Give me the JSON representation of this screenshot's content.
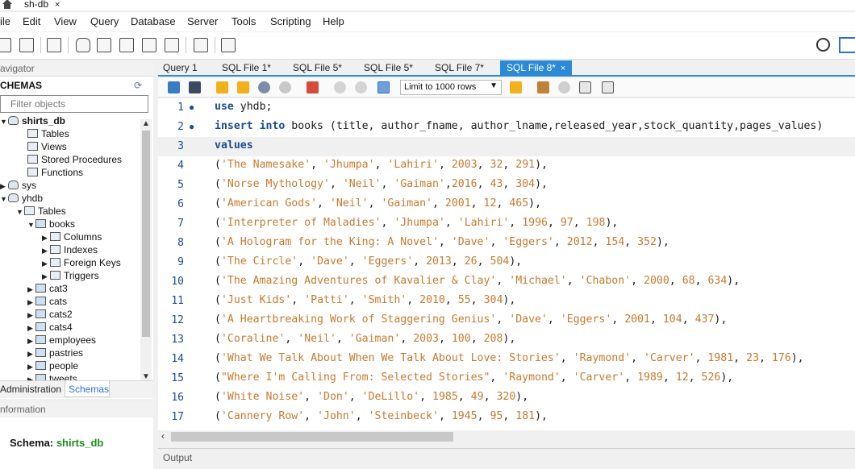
{
  "window": {
    "tab_title": "sh-db",
    "tab_close": "×"
  },
  "menu": [
    "ile",
    "Edit",
    "View",
    "Query",
    "Database",
    "Server",
    "Tools",
    "Scripting",
    "Help"
  ],
  "navigator": {
    "title": "avigator",
    "schemas_label": "CHEMAS",
    "filter_placeholder": "Filter objects",
    "tree": [
      {
        "label": "shirts_db",
        "arrow": "▼",
        "icon": "db",
        "bold": true
      },
      {
        "label": "Tables",
        "icon": "folder"
      },
      {
        "label": "Views",
        "icon": "folder"
      },
      {
        "label": "Stored Procedures",
        "icon": "folder"
      },
      {
        "label": "Functions",
        "icon": "folder"
      },
      {
        "label": "sys",
        "arrow": "▶",
        "icon": "db"
      },
      {
        "label": "yhdb",
        "arrow": "▼",
        "icon": "db"
      },
      {
        "label": "Tables",
        "arrow": "▼",
        "icon": "folder"
      },
      {
        "label": "books",
        "arrow": "▼",
        "icon": "table"
      },
      {
        "label": "Columns",
        "arrow": "▶",
        "icon": "folder"
      },
      {
        "label": "Indexes",
        "arrow": "▶",
        "icon": "folder"
      },
      {
        "label": "Foreign Keys",
        "arrow": "▶",
        "icon": "folder"
      },
      {
        "label": "Triggers",
        "arrow": "▶",
        "icon": "folder"
      },
      {
        "label": "cat3",
        "arrow": "▶",
        "icon": "table"
      },
      {
        "label": "cats",
        "arrow": "▶",
        "icon": "table"
      },
      {
        "label": "cats2",
        "arrow": "▶",
        "icon": "table"
      },
      {
        "label": "cats4",
        "arrow": "▶",
        "icon": "table"
      },
      {
        "label": "employees",
        "arrow": "▶",
        "icon": "table"
      },
      {
        "label": "pastries",
        "arrow": "▶",
        "icon": "table"
      },
      {
        "label": "people",
        "arrow": "▶",
        "icon": "table"
      },
      {
        "label": "tweets",
        "arrow": "▶",
        "icon": "table"
      }
    ],
    "tabs": {
      "admin": "Administration",
      "schemas": "Schemas"
    },
    "info_title": "nformation",
    "schema_info_label": "Schema:",
    "schema_info_value": "shirts_db"
  },
  "query_tabs": [
    {
      "label": "Query 1",
      "active": false
    },
    {
      "label": "SQL File 1*",
      "active": false
    },
    {
      "label": "SQL File 5*",
      "active": false
    },
    {
      "label": "SQL File 5*",
      "active": false
    },
    {
      "label": "SQL File 7*",
      "active": false
    },
    {
      "label": "SQL File 8*",
      "active": true,
      "close": "×"
    }
  ],
  "editor_toolbar": {
    "limit_label": "Limit to 1000 rows"
  },
  "editor": {
    "current_line": 3,
    "lines": [
      {
        "n": "1",
        "dot": true,
        "tokens": [
          [
            "kw",
            "use"
          ],
          [
            "t",
            " yhdb;"
          ]
        ]
      },
      {
        "n": "2",
        "dot": true,
        "tokens": [
          [
            "kw",
            "insert into"
          ],
          [
            "t",
            " books (title, author_fname, author_lname,released_year,stock_quantity,pages_values)"
          ]
        ]
      },
      {
        "n": "3",
        "dot": false,
        "tokens": [
          [
            "kw",
            "values"
          ]
        ]
      },
      {
        "n": "4",
        "dot": false,
        "tokens": [
          [
            "t",
            "("
          ],
          [
            "str",
            "'The Namesake'"
          ],
          [
            "t",
            ", "
          ],
          [
            "str",
            "'Jhumpa'"
          ],
          [
            "t",
            ", "
          ],
          [
            "str",
            "'Lahiri'"
          ],
          [
            "t",
            ", "
          ],
          [
            "num",
            "2003"
          ],
          [
            "t",
            ", "
          ],
          [
            "num",
            "32"
          ],
          [
            "t",
            ", "
          ],
          [
            "num",
            "291"
          ],
          [
            "t",
            "),"
          ]
        ]
      },
      {
        "n": "5",
        "dot": false,
        "tokens": [
          [
            "t",
            "("
          ],
          [
            "str",
            "'Norse Mythology'"
          ],
          [
            "t",
            ", "
          ],
          [
            "str",
            "'Neil'"
          ],
          [
            "t",
            ", "
          ],
          [
            "str",
            "'Gaiman'"
          ],
          [
            "t",
            ","
          ],
          [
            "num",
            "2016"
          ],
          [
            "t",
            ", "
          ],
          [
            "num",
            "43"
          ],
          [
            "t",
            ", "
          ],
          [
            "num",
            "304"
          ],
          [
            "t",
            "),"
          ]
        ]
      },
      {
        "n": "6",
        "dot": false,
        "tokens": [
          [
            "t",
            "("
          ],
          [
            "str",
            "'American Gods'"
          ],
          [
            "t",
            ", "
          ],
          [
            "str",
            "'Neil'"
          ],
          [
            "t",
            ", "
          ],
          [
            "str",
            "'Gaiman'"
          ],
          [
            "t",
            ", "
          ],
          [
            "num",
            "2001"
          ],
          [
            "t",
            ", "
          ],
          [
            "num",
            "12"
          ],
          [
            "t",
            ", "
          ],
          [
            "num",
            "465"
          ],
          [
            "t",
            "),"
          ]
        ]
      },
      {
        "n": "7",
        "dot": false,
        "tokens": [
          [
            "t",
            "("
          ],
          [
            "str",
            "'Interpreter of Maladies'"
          ],
          [
            "t",
            ", "
          ],
          [
            "str",
            "'Jhumpa'"
          ],
          [
            "t",
            ", "
          ],
          [
            "str",
            "'Lahiri'"
          ],
          [
            "t",
            ", "
          ],
          [
            "num",
            "1996"
          ],
          [
            "t",
            ", "
          ],
          [
            "num",
            "97"
          ],
          [
            "t",
            ", "
          ],
          [
            "num",
            "198"
          ],
          [
            "t",
            "),"
          ]
        ]
      },
      {
        "n": "8",
        "dot": false,
        "tokens": [
          [
            "t",
            "("
          ],
          [
            "str",
            "'A Hologram for the King: A Novel'"
          ],
          [
            "t",
            ", "
          ],
          [
            "str",
            "'Dave'"
          ],
          [
            "t",
            ", "
          ],
          [
            "str",
            "'Eggers'"
          ],
          [
            "t",
            ", "
          ],
          [
            "num",
            "2012"
          ],
          [
            "t",
            ", "
          ],
          [
            "num",
            "154"
          ],
          [
            "t",
            ", "
          ],
          [
            "num",
            "352"
          ],
          [
            "t",
            "),"
          ]
        ]
      },
      {
        "n": "9",
        "dot": false,
        "tokens": [
          [
            "t",
            "("
          ],
          [
            "str",
            "'The Circle'"
          ],
          [
            "t",
            ", "
          ],
          [
            "str",
            "'Dave'"
          ],
          [
            "t",
            ", "
          ],
          [
            "str",
            "'Eggers'"
          ],
          [
            "t",
            ", "
          ],
          [
            "num",
            "2013"
          ],
          [
            "t",
            ", "
          ],
          [
            "num",
            "26"
          ],
          [
            "t",
            ", "
          ],
          [
            "num",
            "504"
          ],
          [
            "t",
            "),"
          ]
        ]
      },
      {
        "n": "10",
        "dot": false,
        "tokens": [
          [
            "t",
            "("
          ],
          [
            "str",
            "'The Amazing Adventures of Kavalier & Clay'"
          ],
          [
            "t",
            ", "
          ],
          [
            "str",
            "'Michael'"
          ],
          [
            "t",
            ", "
          ],
          [
            "str",
            "'Chabon'"
          ],
          [
            "t",
            ", "
          ],
          [
            "num",
            "2000"
          ],
          [
            "t",
            ", "
          ],
          [
            "num",
            "68"
          ],
          [
            "t",
            ", "
          ],
          [
            "num",
            "634"
          ],
          [
            "t",
            "),"
          ]
        ]
      },
      {
        "n": "11",
        "dot": false,
        "tokens": [
          [
            "t",
            "("
          ],
          [
            "str",
            "'Just Kids'"
          ],
          [
            "t",
            ", "
          ],
          [
            "str",
            "'Patti'"
          ],
          [
            "t",
            ", "
          ],
          [
            "str",
            "'Smith'"
          ],
          [
            "t",
            ", "
          ],
          [
            "num",
            "2010"
          ],
          [
            "t",
            ", "
          ],
          [
            "num",
            "55"
          ],
          [
            "t",
            ", "
          ],
          [
            "num",
            "304"
          ],
          [
            "t",
            "),"
          ]
        ]
      },
      {
        "n": "12",
        "dot": false,
        "tokens": [
          [
            "t",
            "("
          ],
          [
            "str",
            "'A Heartbreaking Work of Staggering Genius'"
          ],
          [
            "t",
            ", "
          ],
          [
            "str",
            "'Dave'"
          ],
          [
            "t",
            ", "
          ],
          [
            "str",
            "'Eggers'"
          ],
          [
            "t",
            ", "
          ],
          [
            "num",
            "2001"
          ],
          [
            "t",
            ", "
          ],
          [
            "num",
            "104"
          ],
          [
            "t",
            ", "
          ],
          [
            "num",
            "437"
          ],
          [
            "t",
            "),"
          ]
        ]
      },
      {
        "n": "13",
        "dot": false,
        "tokens": [
          [
            "t",
            "("
          ],
          [
            "str",
            "'Coraline'"
          ],
          [
            "t",
            ", "
          ],
          [
            "str",
            "'Neil'"
          ],
          [
            "t",
            ", "
          ],
          [
            "str",
            "'Gaiman'"
          ],
          [
            "t",
            ", "
          ],
          [
            "num",
            "2003"
          ],
          [
            "t",
            ", "
          ],
          [
            "num",
            "100"
          ],
          [
            "t",
            ", "
          ],
          [
            "num",
            "208"
          ],
          [
            "t",
            "),"
          ]
        ]
      },
      {
        "n": "14",
        "dot": false,
        "tokens": [
          [
            "t",
            "("
          ],
          [
            "str",
            "'What We Talk About When We Talk About Love: Stories'"
          ],
          [
            "t",
            ", "
          ],
          [
            "str",
            "'Raymond'"
          ],
          [
            "t",
            ", "
          ],
          [
            "str",
            "'Carver'"
          ],
          [
            "t",
            ", "
          ],
          [
            "num",
            "1981"
          ],
          [
            "t",
            ", "
          ],
          [
            "num",
            "23"
          ],
          [
            "t",
            ", "
          ],
          [
            "num",
            "176"
          ],
          [
            "t",
            "),"
          ]
        ]
      },
      {
        "n": "15",
        "dot": false,
        "tokens": [
          [
            "t",
            "("
          ],
          [
            "str",
            "\"Where I'm Calling From: Selected Stories\""
          ],
          [
            "t",
            ", "
          ],
          [
            "str",
            "'Raymond'"
          ],
          [
            "t",
            ", "
          ],
          [
            "str",
            "'Carver'"
          ],
          [
            "t",
            ", "
          ],
          [
            "num",
            "1989"
          ],
          [
            "t",
            ", "
          ],
          [
            "num",
            "12"
          ],
          [
            "t",
            ", "
          ],
          [
            "num",
            "526"
          ],
          [
            "t",
            "),"
          ]
        ]
      },
      {
        "n": "16",
        "dot": false,
        "tokens": [
          [
            "t",
            "("
          ],
          [
            "str",
            "'White Noise'"
          ],
          [
            "t",
            ", "
          ],
          [
            "str",
            "'Don'"
          ],
          [
            "t",
            ", "
          ],
          [
            "str",
            "'DeLillo'"
          ],
          [
            "t",
            ", "
          ],
          [
            "num",
            "1985"
          ],
          [
            "t",
            ", "
          ],
          [
            "num",
            "49"
          ],
          [
            "t",
            ", "
          ],
          [
            "num",
            "320"
          ],
          [
            "t",
            "),"
          ]
        ]
      },
      {
        "n": "17",
        "dot": false,
        "tokens": [
          [
            "t",
            "("
          ],
          [
            "str",
            "'Cannery Row'"
          ],
          [
            "t",
            ", "
          ],
          [
            "str",
            "'John'"
          ],
          [
            "t",
            ", "
          ],
          [
            "str",
            "'Steinbeck'"
          ],
          [
            "t",
            ", "
          ],
          [
            "num",
            "1945"
          ],
          [
            "t",
            ", "
          ],
          [
            "num",
            "95"
          ],
          [
            "t",
            ", "
          ],
          [
            "num",
            "181"
          ],
          [
            "t",
            "),"
          ]
        ]
      }
    ]
  },
  "output_label": "Output",
  "colors": {
    "accent": "#2a8ad6",
    "keyword": "#1a4d8f",
    "string": "#c77a2e",
    "schema_value": "#1f8a1f"
  },
  "icons": [
    "home-icon",
    "refresh-icon",
    "gear-icon",
    "panel-toggle-icon"
  ]
}
